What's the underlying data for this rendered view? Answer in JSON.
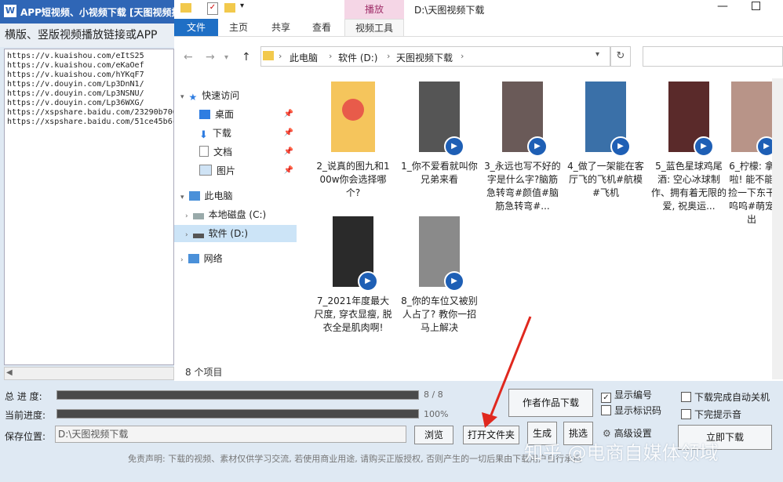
{
  "app": {
    "title": "APP短视频、小视频下载 [天图视频挂",
    "heading": "横版、竖版视频播放链接或APP",
    "urls": [
      "https://v.kuaishou.com/eItS25",
      "https://v.kuaishou.com/eKaOef",
      "https://v.kuaishou.com/hYKqF7",
      "https://v.douyin.com/Lp3DnN1/",
      "https://v.douyin.com/Lp3NSNU/",
      "https://v.douyin.com/Lp36WXG/",
      "https://xspshare.baidu.com/23290b706",
      "https://xspshare.baidu.com/51ce45b6c"
    ]
  },
  "explorer": {
    "window_title": "D:\\天图视频下载",
    "play_tab": "播放",
    "ribbon_tabs": [
      "文件",
      "主页",
      "共享",
      "查看",
      "视频工具"
    ],
    "breadcrumb": [
      "此电脑",
      "软件 (D:)",
      "天图视频下载"
    ],
    "nav": {
      "quick_access": "快速访问",
      "desktop": "桌面",
      "downloads": "下载",
      "documents": "文档",
      "pictures": "图片",
      "this_pc": "此电脑",
      "drive_c": "本地磁盘 (C:)",
      "drive_d": "软件 (D:)",
      "network": "网络"
    },
    "files": [
      {
        "name": "2_说真的图九和100w你会选择哪个?",
        "type": "folder"
      },
      {
        "name": "1_你不爱看就叫你兄弟来看",
        "type": "video"
      },
      {
        "name": "3_永远也写不好的字是什么字?脑筋急转弯#颜值#脑筋急转弯#...",
        "type": "video"
      },
      {
        "name": "4_做了一架能在客厅飞的飞机#航模#飞机",
        "type": "video"
      },
      {
        "name": "5_蓝色星球鸡尾酒: 空心冰球制作、拥有着无限的爱, 祝奥运...",
        "type": "video"
      },
      {
        "name": "6_柠檬: 拿啦! 能不能捡一下东干呜呜#萌宠出",
        "type": "video"
      },
      {
        "name": "7_2021年度最大尺度, 穿衣显瘦, 脱衣全是肌肉啊!",
        "type": "video"
      },
      {
        "name": "8_你的车位又被别人占了? 教你一招马上解决",
        "type": "video"
      }
    ],
    "status": "8 个项目"
  },
  "bottom": {
    "total_progress_label": "总 进 度:",
    "total_progress_value": "8 / 8",
    "total_progress_fraction": 1.0,
    "current_progress_label": "当前进度:",
    "current_progress_value": "100%",
    "current_progress_fraction": 1.0,
    "save_label": "保存位置:",
    "save_path": "D:\\天图视频下载",
    "browse": "浏览",
    "open_folder": "打开文件夹",
    "author_works": "作者作品下载",
    "generate": "生成",
    "pick": "挑选",
    "show_number": "显示编号",
    "show_id": "显示标识码",
    "advanced": "高级设置",
    "shutdown": "下载完成自动关机",
    "no_sound": "下完提示音",
    "download_now": "立即下载",
    "disclaimer": "免责声明: 下载的视频、素材仅供学习交流, 若使用商业用途, 请购买正版授权, 否则产生的一切后果由下载用户自行承担",
    "watermark": "知乎 @电商自媒体领域"
  }
}
